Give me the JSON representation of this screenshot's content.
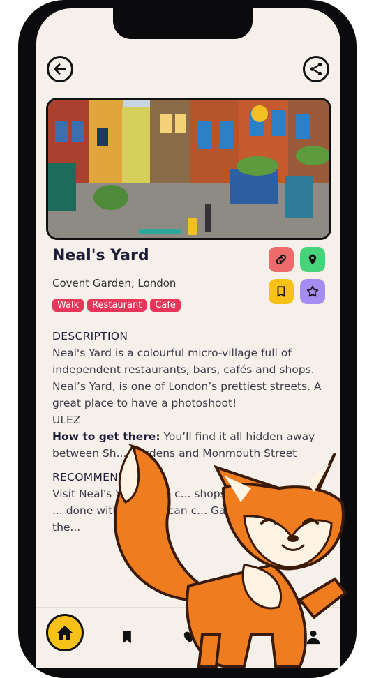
{
  "colors": {
    "screen_bg": "#f6f0eb",
    "tag_bg": "#e8365a",
    "link_btn": "#ee6b6b",
    "map_btn": "#47d37a",
    "bookmark_btn": "#f7c117",
    "star_btn": "#a58cf0",
    "home_btn": "#f7c117",
    "fox_orange": "#ef7d20"
  },
  "header": {
    "back_icon": "arrow-left-icon",
    "share_icon": "share-icon"
  },
  "place": {
    "name": "Neal's Yard",
    "location": "Covent Garden, London",
    "tags": [
      "Walk",
      "Restaurant",
      "Cafe"
    ]
  },
  "actions": [
    {
      "icon": "link-icon"
    },
    {
      "icon": "map-pin-icon"
    },
    {
      "icon": "bookmark-icon"
    },
    {
      "icon": "star-icon"
    }
  ],
  "description": {
    "heading": "DESCRIPTION",
    "body": "Neal's Yard is a colourful micro-village full of independent restaurants, bars, cafés and shops. Neal’s Yard, is one of London’s prettiest streets. A great place to have a photoshoot!",
    "ulez": "ULEZ",
    "how_label": "How to get there:",
    "how_text": " You’ll find it all hidden away between Sh... Gardens and Monmouth Street"
  },
  "recommended": {
    "heading": "RECOMMENDE...",
    "body": "Visit Neal's Ya...all the c... shops! There... do and ... done with N... you can c... Garden and... st of the..."
  },
  "navbar": {
    "items": [
      "home-icon",
      "bookmark-icon",
      "heart-icon",
      "profile-icon"
    ]
  }
}
